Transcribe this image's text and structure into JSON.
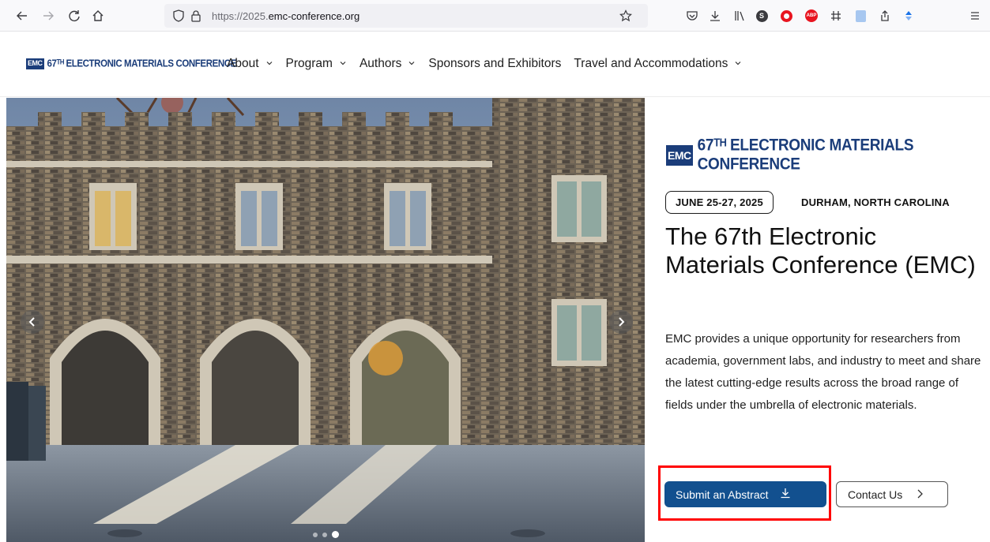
{
  "browser": {
    "url_dim": "https://2025.",
    "url_main": "emc-conference.org",
    "icons": [
      "back-icon",
      "forward-icon",
      "reload-icon",
      "home-icon",
      "shield-icon",
      "lock-icon",
      "bookmark-star-icon",
      "pocket-icon",
      "download-icon",
      "library-icon",
      "extension-icon",
      "opera-icon",
      "adblock-icon",
      "grid-icon",
      "reader-icon",
      "share-icon",
      "extension-blue-icon",
      "menu-icon"
    ]
  },
  "header": {
    "logo_badge": "EMC",
    "logo_text": "67ᵀᴴ ELECTRONIC MATERIALS CONFERENCE",
    "menu": [
      {
        "label": "About",
        "has_dropdown": true
      },
      {
        "label": "Program",
        "has_dropdown": true
      },
      {
        "label": "Authors",
        "has_dropdown": true
      },
      {
        "label": "Sponsors and Exhibitors",
        "has_dropdown": false
      },
      {
        "label": "Travel and Accommodations",
        "has_dropdown": true
      }
    ]
  },
  "hero": {
    "carousel_dots": 3,
    "active_dot": 2
  },
  "panel": {
    "logo_badge": "EMC",
    "logo_text": "67ᵀᴴ ELECTRONIC MATERIALS CONFERENCE",
    "date": "JUNE 25-27, 2025",
    "location": "DURHAM, NORTH CAROLINA",
    "title": "The 67th Electronic Materials Conference (EMC)",
    "description": "EMC provides a unique opportunity for researchers from  academia, government labs, and industry to meet and share the  latest cutting-edge results across the broad range of fields under  the umbrella of electronic materials.",
    "submit_label": "Submit an Abstract",
    "contact_label": "Contact Us"
  },
  "colors": {
    "brand_blue": "#1b3d7a",
    "button_blue": "#12508f",
    "highlight_red": "#ff0000"
  }
}
